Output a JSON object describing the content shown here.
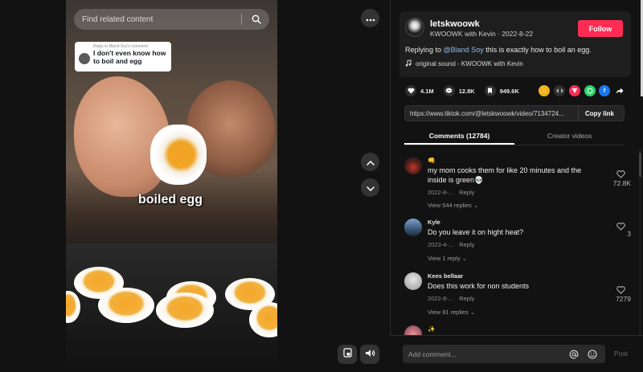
{
  "video": {
    "search_placeholder": "Find related content",
    "reply_card": {
      "header": "Reply to Bland Soy's comment",
      "text": "I don't even know how to boil and egg"
    },
    "caption": "boiled egg",
    "icons": {
      "search": "search-icon",
      "more": "more-icon",
      "up": "chevron-up-icon",
      "down": "chevron-down-icon",
      "pip": "picture-in-picture-icon",
      "volume": "volume-icon"
    }
  },
  "author": {
    "username": "letskwoowk",
    "nickname": "KWOOWK with Kevin",
    "date": "2022-8-22",
    "follow_label": "Follow",
    "description_prefix": "Replying to ",
    "mention": "@Bland Soy",
    "description_suffix": " this is exactly how to boil an egg.",
    "sound": "original sound - KWOOWK with Kevin"
  },
  "actions": {
    "likes": "4.1M",
    "comments": "12.8K",
    "saves": "949.6K",
    "share_targets": [
      "embed",
      "code",
      "direct",
      "whatsapp",
      "facebook",
      "share"
    ]
  },
  "link": {
    "url": "https://www.tiktok.com/@letskwoowk/video/7134724...",
    "copy_label": "Copy link"
  },
  "tabs": [
    {
      "label": "Comments (12784)",
      "active": true
    },
    {
      "label": "Creator videos",
      "active": false
    }
  ],
  "comments": [
    {
      "name": "👊",
      "text": "my mom cooks them for like 20 minutes and the inside is green💀",
      "date": "2022-8-...",
      "reply": "Reply",
      "more": "View 544 replies",
      "likes": "72.8K"
    },
    {
      "name": "Kyle",
      "text": "Do you leave it on hight heat?",
      "date": "2023-4-...",
      "reply": "Reply",
      "more": "View 1 reply",
      "likes": "3"
    },
    {
      "name": "Kees bellaar",
      "text": "Does this work for non students",
      "date": "2022-8-...",
      "reply": "Reply",
      "more": "View 81 replies",
      "likes": "7279"
    },
    {
      "name": "✨",
      "text": "",
      "date": "",
      "reply": "",
      "more": "",
      "likes": ""
    }
  ],
  "composer": {
    "placeholder": "Add comment...",
    "post_label": "Post"
  },
  "colors": {
    "accent": "#fe2c55",
    "mention": "#8fb9ea",
    "panel_bg": "#121212"
  }
}
